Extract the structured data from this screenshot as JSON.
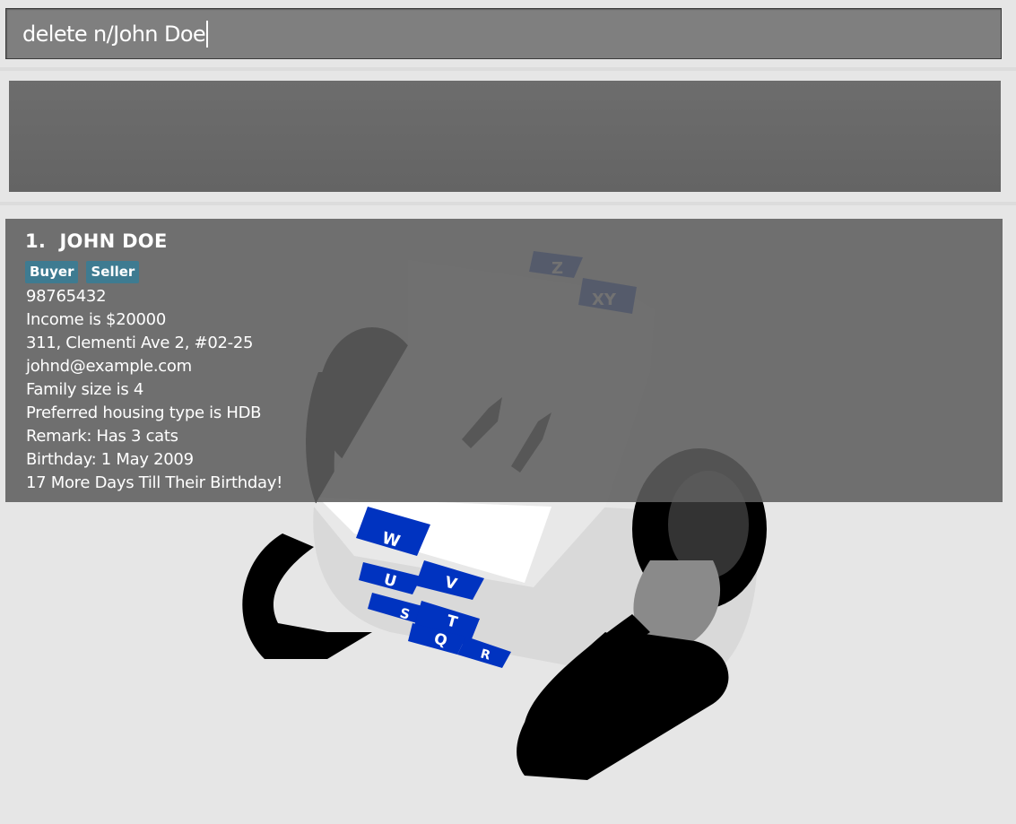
{
  "command_box": {
    "value": "delete n/John Doe"
  },
  "result_display": {
    "text": ""
  },
  "person_list": [
    {
      "index": "1.",
      "name": "JOHN DOE",
      "tags": [
        "Buyer",
        "Seller"
      ],
      "phone": "98765432",
      "income": "Income is $20000",
      "address": "311, Clementi Ave 2, #02-25",
      "email": "johnd@example.com",
      "family_size": "Family size is 4",
      "housing_type": "Preferred housing type is HDB",
      "remark": "Remark: Has 3 cats",
      "birthday": "Birthday: 1 May 2009",
      "birthday_countdown": "17 More Days Till Their Birthday!"
    }
  ],
  "background_image": {
    "icon": "rolodex-icon",
    "tab_letters": [
      "Z",
      "XY",
      "W",
      "U",
      "V",
      "S",
      "T",
      "Q",
      "R"
    ],
    "tab_color": "#0033c0"
  },
  "colors": {
    "window_bg": "#e6e6e6",
    "command_bg": "#7f7f7f",
    "result_bg": "#666666",
    "card_bg": "#5f5f5f",
    "tag_bg": "#3e7b91"
  }
}
